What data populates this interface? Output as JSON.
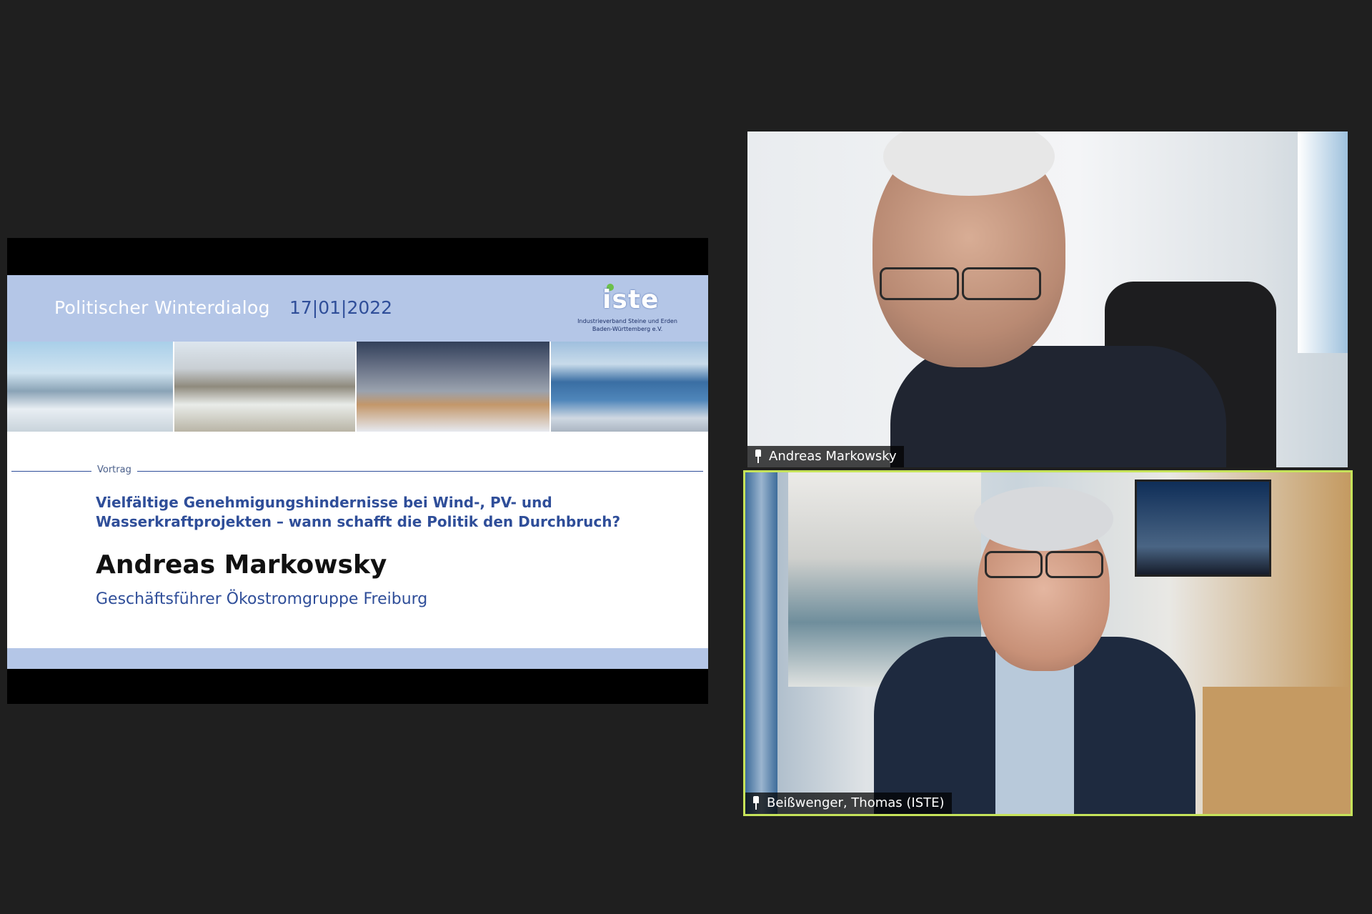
{
  "shared_slide": {
    "header_title": "Politischer Winterdialog",
    "header_date": "17|01|2022",
    "logo": {
      "word": "iste",
      "subtitle": "Industrieverband Steine und Erden\nBaden-Württemberg e.V."
    },
    "section_label": "Vortrag",
    "talk_title": "Vielfältige Genehmigungshindernisse bei Wind-, PV- und Wasserkraftprojekten – wann schafft die Politik den Durchbruch?",
    "speaker_name": "Andreas Markowsky",
    "speaker_role": "Geschäftsführer Ökostromgruppe Freiburg"
  },
  "participants": [
    {
      "name": "Andreas Markowsky",
      "pinned": true,
      "active_speaker": false
    },
    {
      "name": "Beißwenger, Thomas (ISTE)",
      "pinned": true,
      "active_speaker": true
    }
  ],
  "colors": {
    "background": "#1f1f1f",
    "slide_band": "#b4c6e7",
    "slide_accent": "#2f4e99",
    "active_speaker_border": "#c6e35a",
    "logo_green": "#6cc04a"
  },
  "icons": {
    "pin": "pin-icon"
  }
}
